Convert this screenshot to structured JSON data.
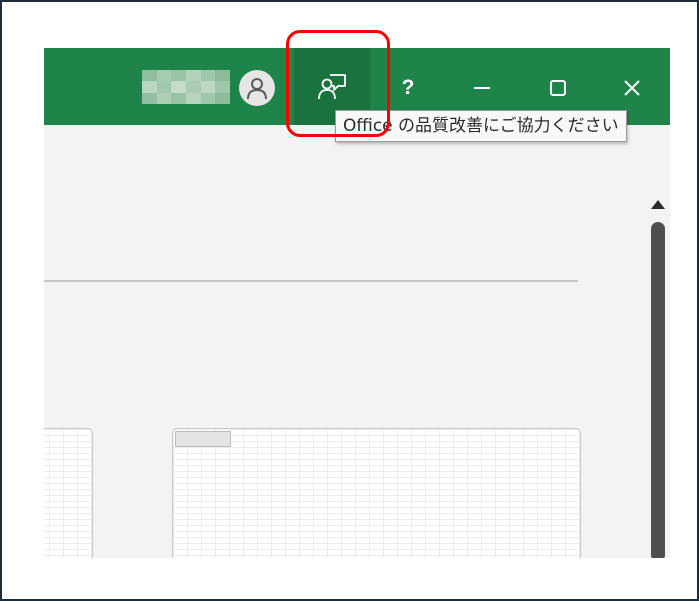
{
  "titlebar": {
    "color": "#1e8449",
    "user_avatar_icon": "person-icon",
    "feedback_button_icon": "feedback-person-icon",
    "help_label": "?",
    "minimize_icon": "minimize-icon",
    "maximize_icon": "maximize-icon",
    "close_icon": "close-icon"
  },
  "tooltip": {
    "text": "Office の品質改善にご協力ください"
  },
  "annotation": {
    "highlight_color": "#ff0000",
    "highlight_target": "feedback-button"
  },
  "content": {
    "scrollbar_thumb_color": "#4e4e4e"
  }
}
